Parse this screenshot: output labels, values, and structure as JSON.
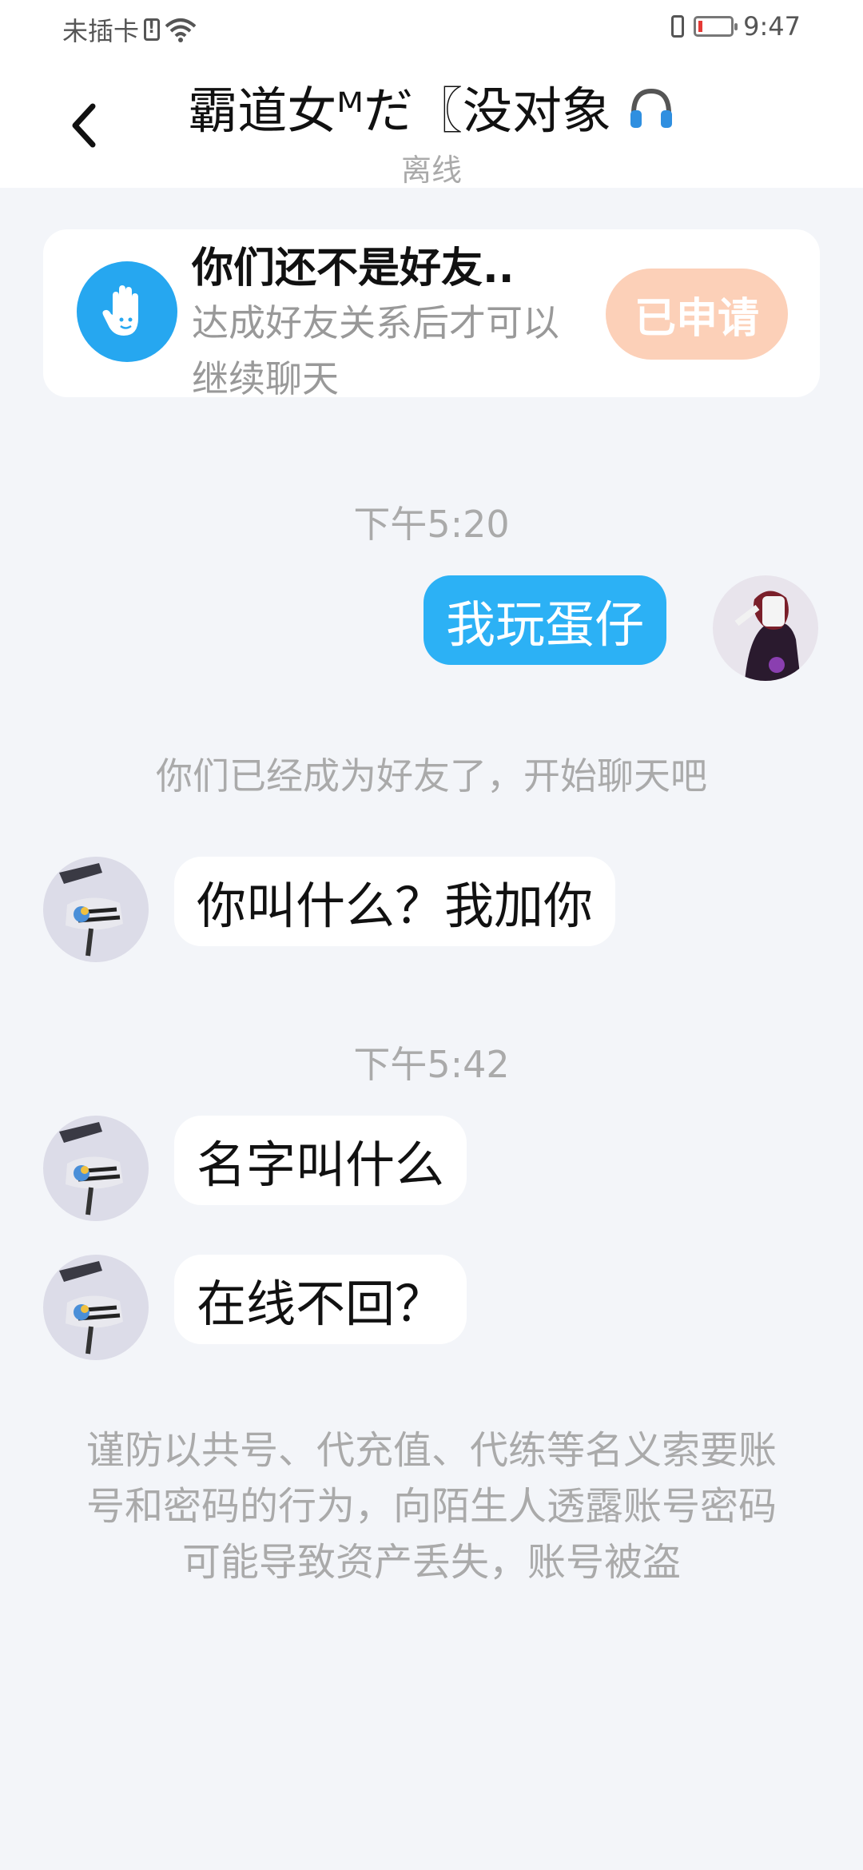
{
  "status_bar": {
    "carrier": "未插卡",
    "time": "9:47"
  },
  "header": {
    "title": "霸道女ᴹだ〖没对象",
    "status": "离线"
  },
  "friend_card": {
    "title": "你们还不是好友..",
    "description": "达成好友关系后才可以继续聊天",
    "button_label": "已申请"
  },
  "messages": [
    {
      "type": "time",
      "text": "下午5:20"
    },
    {
      "type": "out",
      "text": "我玩蛋仔"
    },
    {
      "type": "system",
      "text": "你们已经成为好友了，开始聊天吧"
    },
    {
      "type": "in",
      "text": "你叫什么？我加你"
    },
    {
      "type": "time",
      "text": "下午5:42"
    },
    {
      "type": "in",
      "text": "名字叫什么"
    },
    {
      "type": "in",
      "text": "在线不回？"
    }
  ],
  "warning": "谨防以共号、代充值、代练等名义索要账号和密码的行为，向陌生人透露账号密码可能导致资产丢失，账号被盗",
  "colors": {
    "accent": "#2cb1f5",
    "applied_button": "#fcd0b8",
    "background": "#f3f5f9"
  },
  "icons": {
    "back": "chevron-left-icon",
    "headphones": "headphones-icon",
    "wave": "waving-hand-icon"
  }
}
